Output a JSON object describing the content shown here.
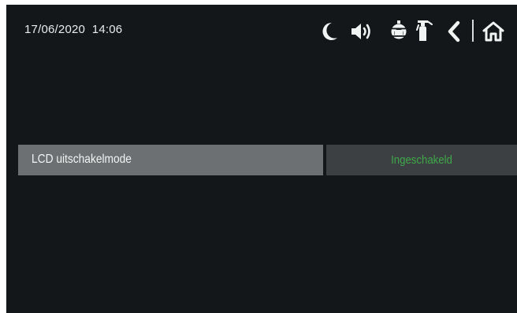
{
  "status_bar": {
    "datetime": "17/06/2020  14:06",
    "icons": [
      "moon-icon",
      "speaker-icon",
      "alarm-bell-icon",
      "fire-extinguisher-icon",
      "back-chevron-icon",
      "home-icon"
    ]
  },
  "settings": {
    "rows": [
      {
        "label": "LCD uitschakelmode",
        "value": "Ingeschakeld"
      }
    ]
  },
  "colors": {
    "background": "#131719",
    "label_cell": "#6d7072",
    "value_cell": "#3d4042",
    "value_text": "#3fa84a",
    "icon": "#f2f4f4"
  }
}
